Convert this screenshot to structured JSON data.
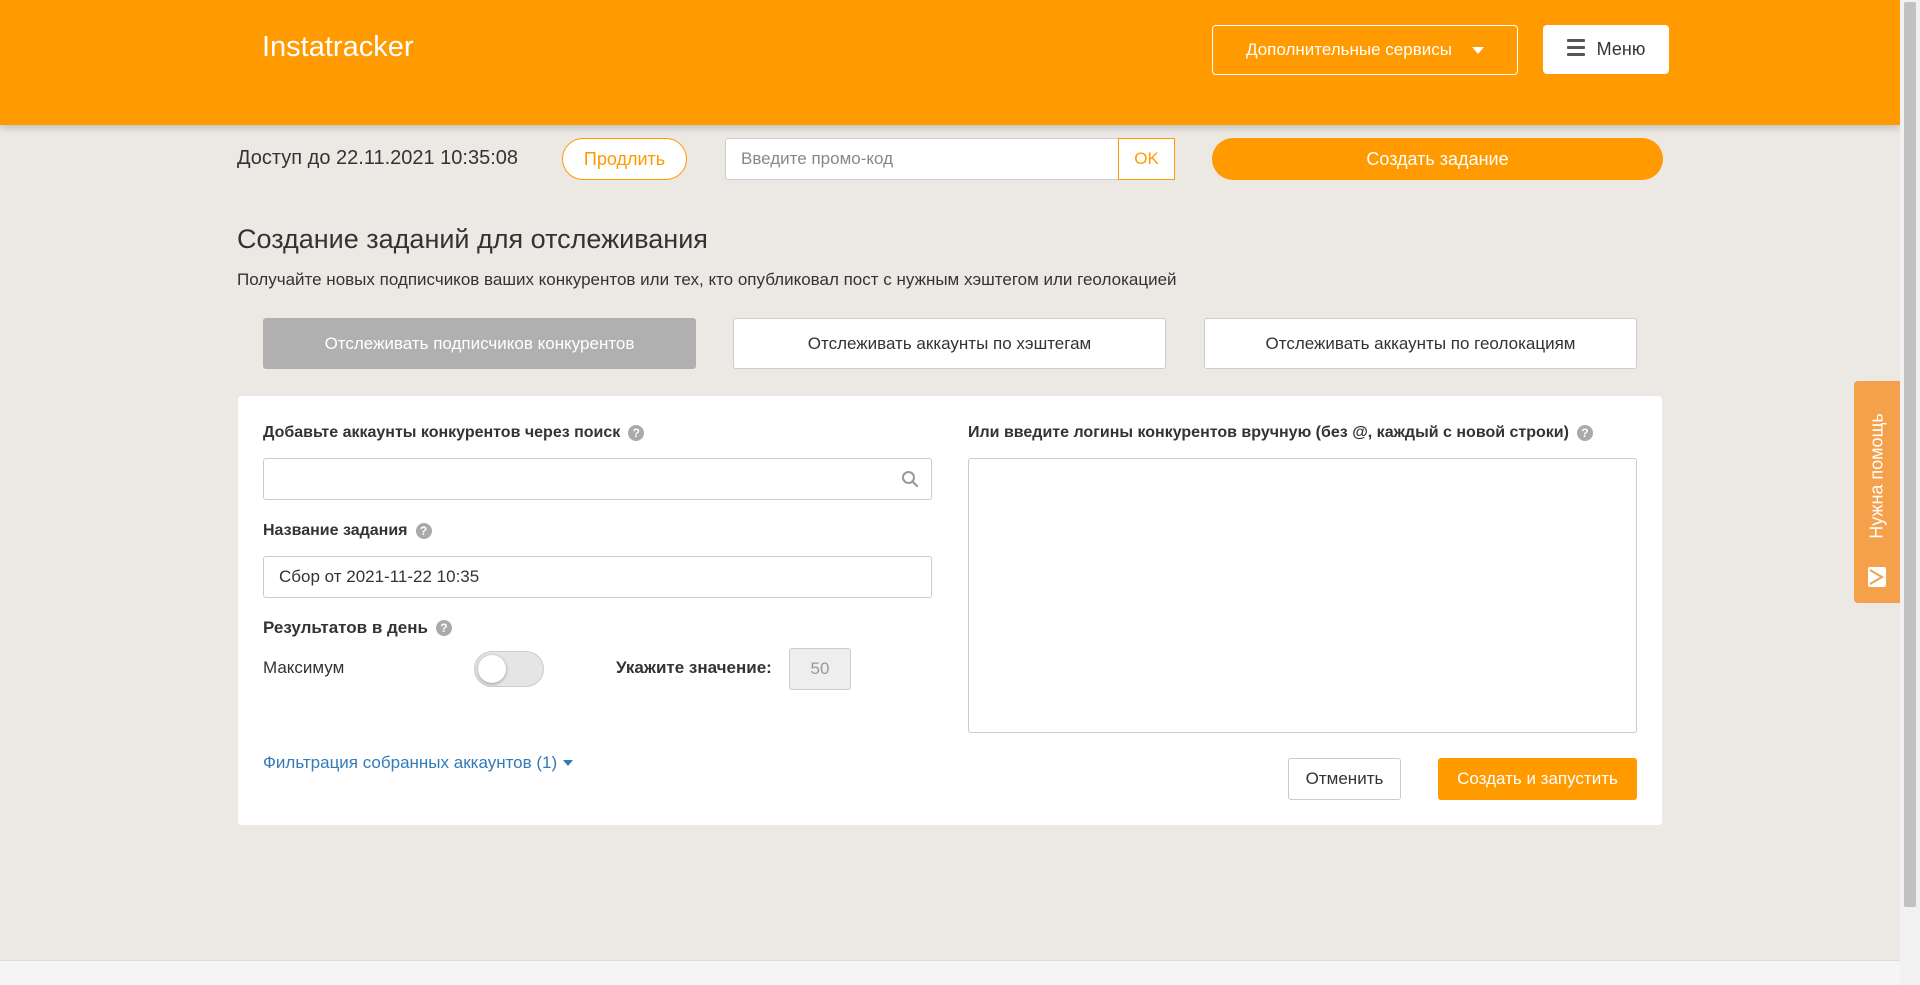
{
  "header": {
    "logo": "Instatracker",
    "services_label": "Дополнительные сервисы",
    "menu_label": "Меню"
  },
  "access": {
    "text": "Доступ до 22.11.2021 10:35:08",
    "extend_label": "Продлить",
    "promo_placeholder": "Введите промо-код",
    "promo_ok": "OK",
    "create_task_label": "Создать задание"
  },
  "page": {
    "title": "Создание заданий для отслеживания",
    "subtitle": "Получайте новых подписчиков ваших конкурентов или тех, кто опубликовал пост с нужным хэштегом или геолокацией"
  },
  "tabs": [
    {
      "label": "Отслеживать подписчиков конкурентов",
      "active": true
    },
    {
      "label": "Отслеживать аккаунты по хэштегам",
      "active": false
    },
    {
      "label": "Отслеживать аккаунты по геолокациям",
      "active": false
    }
  ],
  "form": {
    "search_label": "Добавьте аккаунты конкурентов через поиск",
    "search_value": "",
    "task_name_label": "Название задания",
    "task_name_value": "Сбор от 2021-11-22 10:35",
    "results_label": "Результатов в день",
    "maximum_label": "Максимум",
    "maximum_enabled": false,
    "value_label": "Укажите значение:",
    "value": "50",
    "filter_link": "Фильтрация собранных аккаунтов (1)",
    "manual_label": "Или введите логины конкурентов вручную (без @, каждый с новой строки)",
    "manual_value": "",
    "cancel_label": "Отменить",
    "run_label": "Создать и запустить"
  },
  "help_tab": {
    "label": "Нужна помощь"
  },
  "colors": {
    "brand": "#ff9a00",
    "background": "#ece9e5",
    "link": "#337ab7",
    "tab_active": "#b0b0b0"
  },
  "icons": [
    "caret-down-icon",
    "hamburger-icon",
    "help-icon",
    "search-icon",
    "mail-icon"
  ]
}
